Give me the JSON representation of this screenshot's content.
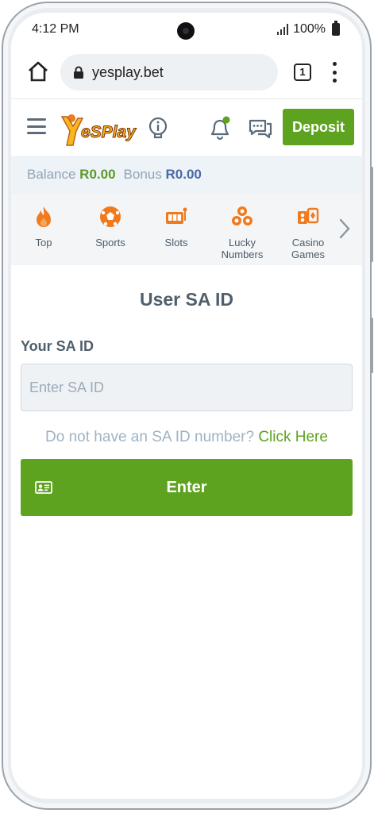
{
  "status_bar": {
    "time": "4:12 PM",
    "battery": "100%"
  },
  "browser": {
    "url": "yesplay.bet",
    "tab_count": "1"
  },
  "header": {
    "deposit_label": "Deposit",
    "logo_text": "YesPlay"
  },
  "balance": {
    "balance_label": "Balance",
    "balance_value": "R0.00",
    "bonus_label": "Bonus",
    "bonus_value": "R0.00"
  },
  "categories": [
    {
      "label": "Top",
      "icon": "fire-icon"
    },
    {
      "label": "Sports",
      "icon": "soccer-ball-icon"
    },
    {
      "label": "Slots",
      "icon": "slot-machine-icon"
    },
    {
      "label": "Lucky Numbers",
      "icon": "lottery-balls-icon"
    },
    {
      "label": "Casino Games",
      "icon": "casino-cards-icon"
    }
  ],
  "form": {
    "title": "User SA ID",
    "field_label": "Your SA ID",
    "placeholder": "Enter SA ID",
    "value": "",
    "help_text": "Do not have an SA ID number?",
    "help_link": "Click Here",
    "submit_label": "Enter"
  },
  "colors": {
    "brand_green": "#5ea320",
    "bonus_blue": "#4b69a8",
    "accent_orange": "#f07a1e"
  }
}
